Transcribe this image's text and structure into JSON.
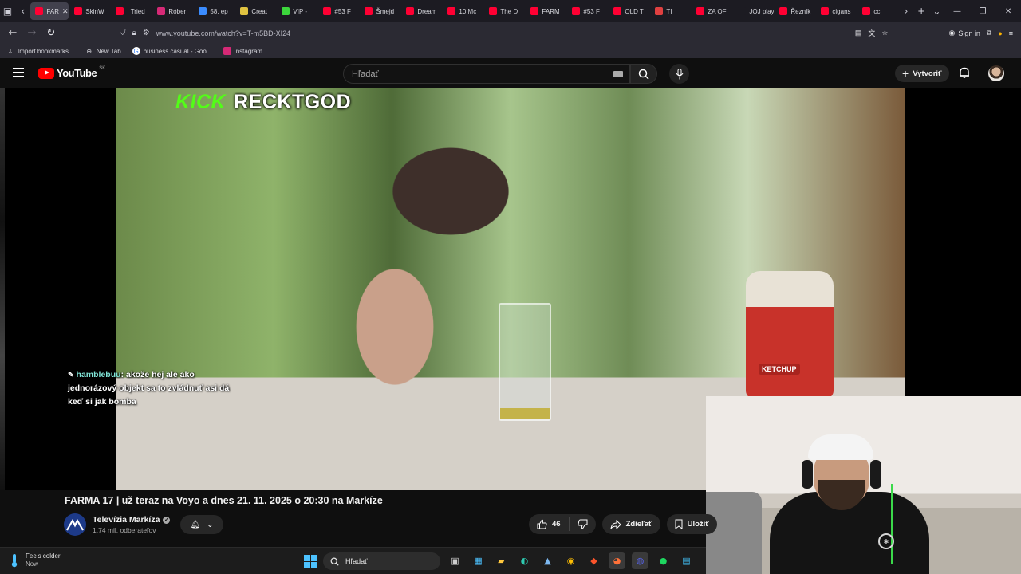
{
  "browser": {
    "tabs": [
      {
        "label": "FAR",
        "color": "#ff0033",
        "active": true
      },
      {
        "label": "SkinW",
        "color": "#ff0033"
      },
      {
        "label": "I Tried",
        "color": "#ff0033"
      },
      {
        "label": "Róber",
        "color": "#d62976"
      },
      {
        "label": "58. ep",
        "color": "#3b8cff"
      },
      {
        "label": "Creat",
        "color": "#e0c341"
      },
      {
        "label": "VIP - ",
        "color": "#3cd63c"
      },
      {
        "label": "#53 F",
        "color": "#ff0033"
      },
      {
        "label": "Šmejd",
        "color": "#ff0033"
      },
      {
        "label": "Dream",
        "color": "#ff0033"
      },
      {
        "label": "10 Mc",
        "color": "#ff0033"
      },
      {
        "label": "The D",
        "color": "#ff0033"
      },
      {
        "label": "FARM",
        "color": "#ff0033"
      },
      {
        "label": "#53 F",
        "color": "#ff0033"
      },
      {
        "label": "OLD T",
        "color": "#ff0033"
      },
      {
        "label": "TI",
        "color": "#e04040"
      },
      {
        "label": "ZA OF",
        "color": "#ff0033"
      },
      {
        "label": "JOJ play",
        "color": "#1c1b22"
      },
      {
        "label": "Řezník",
        "color": "#ff0033"
      },
      {
        "label": "cigans",
        "color": "#ff0033"
      },
      {
        "label": "cc",
        "color": "#ff0033"
      }
    ],
    "url": "www.youtube.com/watch?v=T-m5BD-XI24",
    "sign_in": "Sign in",
    "bookmarks": [
      {
        "label": "Import bookmarks...",
        "icon": "import-icon"
      },
      {
        "label": "New Tab",
        "icon": "globe-icon"
      },
      {
        "label": "business casual - Goo...",
        "icon": "google-icon"
      },
      {
        "label": "Instagram",
        "icon": "instagram-icon"
      }
    ]
  },
  "youtube": {
    "logo_text": "YouTube",
    "region": "SK",
    "search_placeholder": "Hľadať",
    "create_label": "Vytvoriť"
  },
  "video": {
    "watermark_kick": "KICK",
    "watermark_name": "RECKTGOD",
    "product_label": "KETCHUP",
    "chat_user": "hamblebuu",
    "chat_message": ": akože hej ale ako jednorázový objekt sa to zvládnuť asi dá keď si jak bomba"
  },
  "meta": {
    "title": "FARMA 17 | už teraz na Voyo a dnes 21. 11. 2025 o 20:30 na Markíze",
    "channel_name": "Televízia Markíza",
    "subscribers": "1,74 mil. odberateľov",
    "likes": "46",
    "share_label": "Zdieľať",
    "save_label": "Uložiť"
  },
  "taskbar": {
    "weather_title": "Feels colder",
    "weather_sub": "Now",
    "search_label": "Hľadať"
  },
  "colors": {
    "youtube_red": "#ff0000",
    "kick_green": "#53fc18",
    "chat_user": "#7fe3d6"
  }
}
